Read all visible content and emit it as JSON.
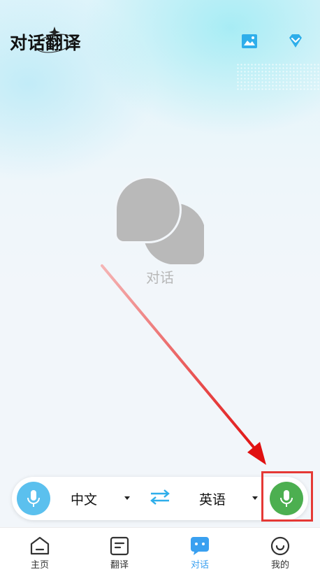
{
  "header": {
    "title": "对话翻译",
    "icons": [
      "image-icon",
      "diamond-vip-icon"
    ]
  },
  "empty_state": {
    "icon": "chat-bubbles-icon",
    "label": "对话"
  },
  "language_bar": {
    "source_language": "中文",
    "target_language": "英语",
    "left_mic_icon": "microphone-icon",
    "right_mic_icon": "microphone-icon",
    "swap_icon": "swap-arrows-icon"
  },
  "tabs": [
    {
      "label": "主页",
      "icon": "home-icon"
    },
    {
      "label": "翻译",
      "icon": "document-icon"
    },
    {
      "label": "对话",
      "icon": "chat-icon",
      "active": true
    },
    {
      "label": "我的",
      "icon": "smiley-icon"
    }
  ],
  "colors": {
    "accent": "#3aa0f0",
    "left_mic": "#5bc0ee",
    "right_mic": "#4caf50",
    "annotation": "#e53935"
  }
}
